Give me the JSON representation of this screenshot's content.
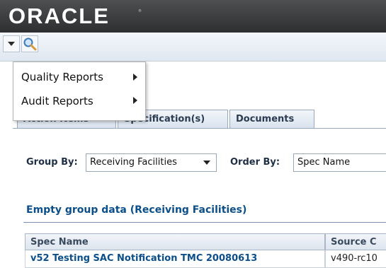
{
  "header": {
    "logo": "ORACLE",
    "registered_mark": "®"
  },
  "toolbar": {
    "menu_caret_icon": "caret-down-icon",
    "search_icon": "search-icon"
  },
  "menu": {
    "items": [
      {
        "label": "Quality Reports",
        "has_submenu": true
      },
      {
        "label": "Audit Reports",
        "has_submenu": true
      }
    ]
  },
  "tabs": [
    {
      "label": "Action Items"
    },
    {
      "label": "Specification(s)"
    },
    {
      "label": "Documents"
    }
  ],
  "filters": {
    "group_by_label": "Group By:",
    "group_by_value": "Receiving Facilities",
    "order_by_label": "Order By:",
    "order_by_value": "Spec Name"
  },
  "group": {
    "title": "Empty group data (Receiving Facilities)"
  },
  "table": {
    "columns": [
      "Spec Name",
      "Source C"
    ],
    "rows": [
      [
        "v52 Testing SAC Notification TMC 20080613",
        "v490-rc10"
      ]
    ]
  },
  "colors": {
    "header_bg": "#3a3b3d",
    "link": "#0b4f8a",
    "toolbar_bg": "#e6edf5"
  }
}
